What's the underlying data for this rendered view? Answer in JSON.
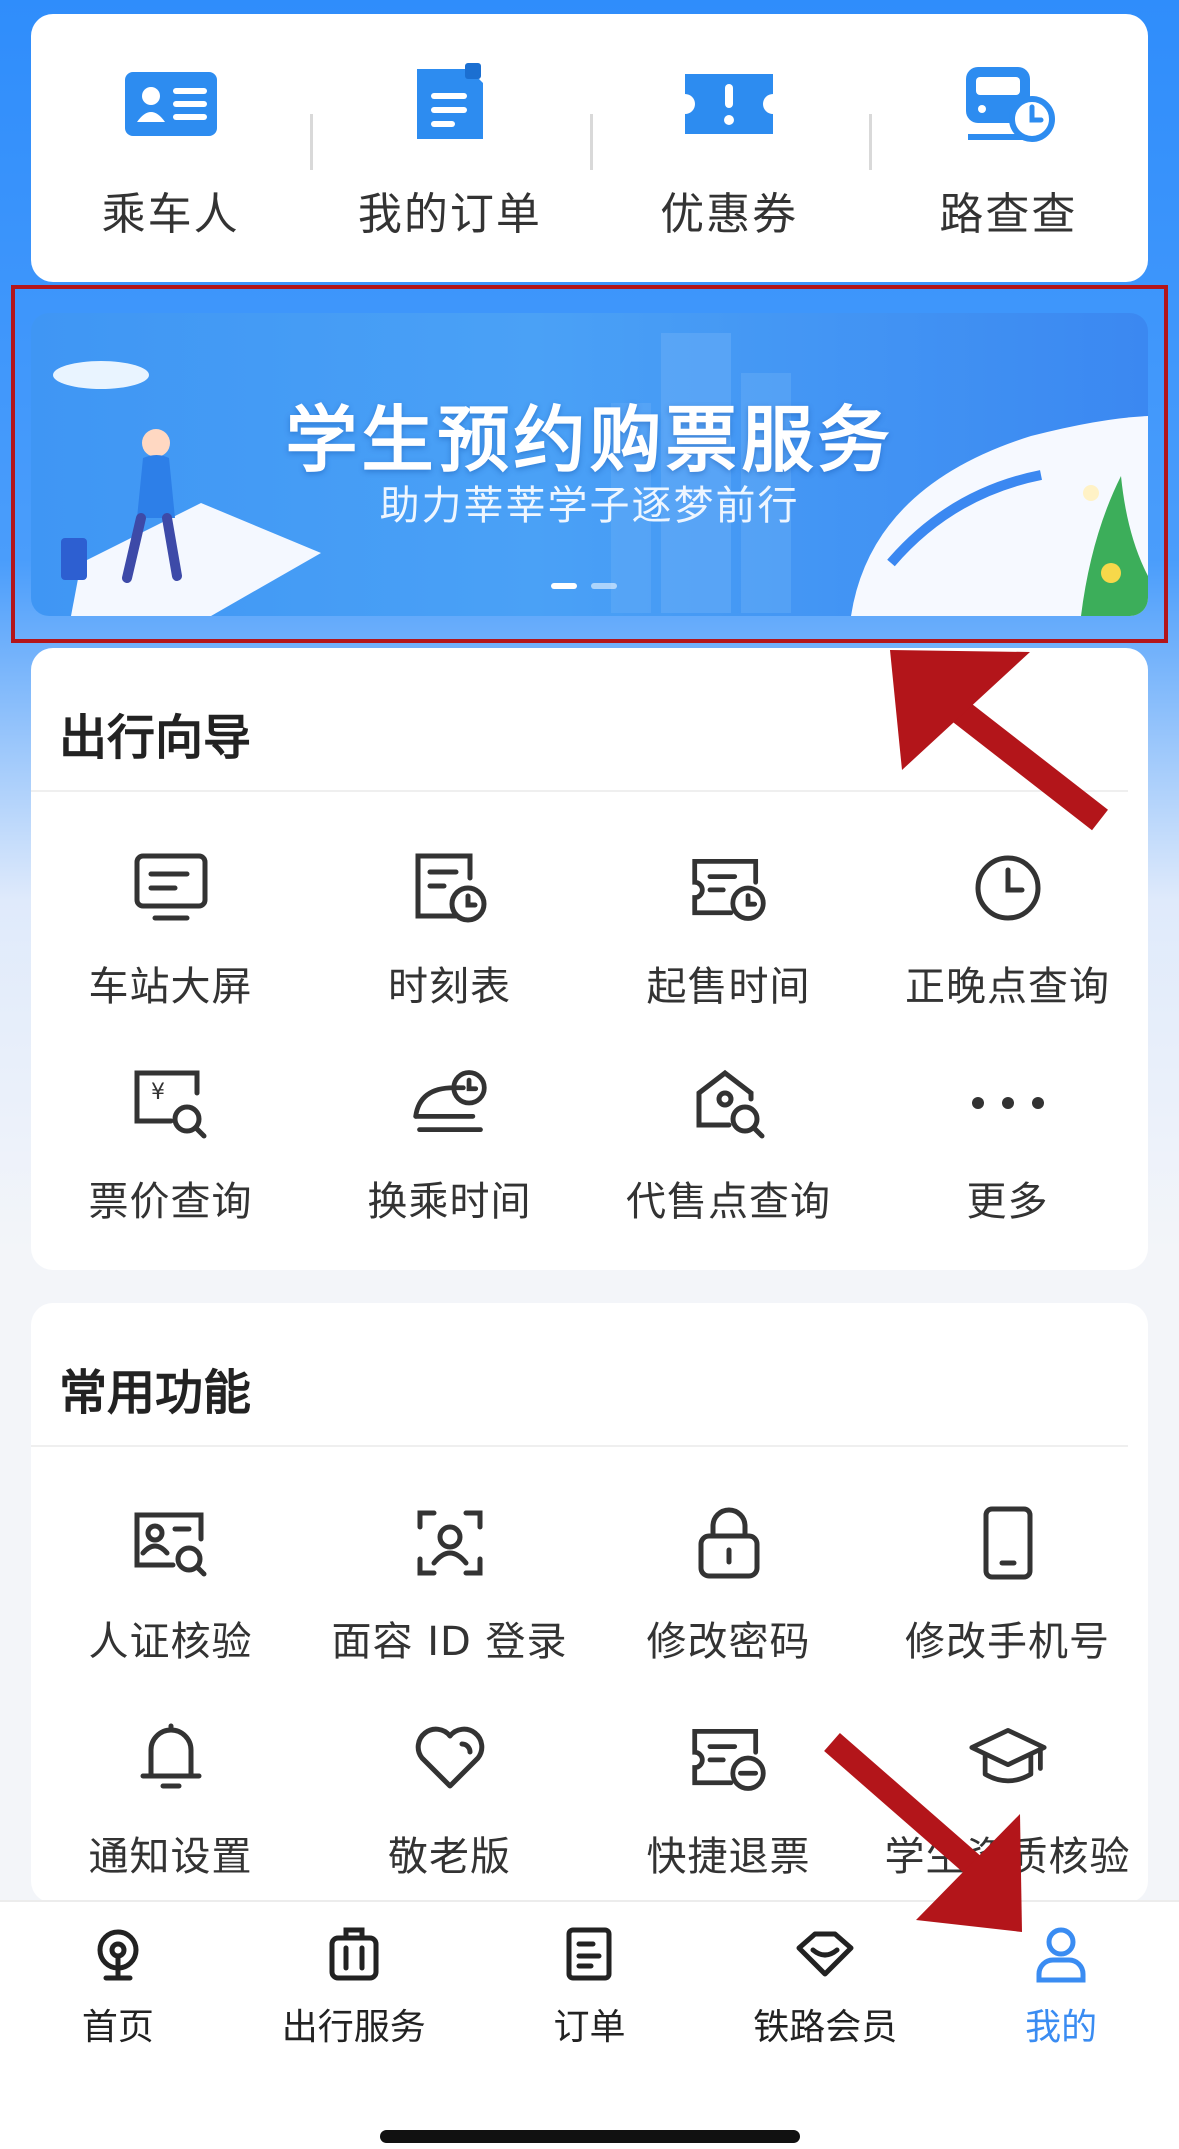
{
  "quick": [
    {
      "label": "乘车人",
      "icon": "passenger-card-icon"
    },
    {
      "label": "我的订单",
      "icon": "order-doc-icon"
    },
    {
      "label": "优惠券",
      "icon": "coupon-icon"
    },
    {
      "label": "路查查",
      "icon": "train-schedule-icon"
    }
  ],
  "banner": {
    "title": "学生预约购票服务",
    "subtitle": "助力莘莘学子逐梦前行"
  },
  "guide": {
    "title": "出行向导",
    "items": [
      {
        "label": "车站大屏",
        "icon": "station-screen-icon"
      },
      {
        "label": "时刻表",
        "icon": "timetable-icon"
      },
      {
        "label": "起售时间",
        "icon": "sale-time-icon"
      },
      {
        "label": "正晚点查询",
        "icon": "clock-icon"
      },
      {
        "label": "票价查询",
        "icon": "fare-search-icon"
      },
      {
        "label": "换乘时间",
        "icon": "transfer-time-icon"
      },
      {
        "label": "代售点查询",
        "icon": "agent-search-icon"
      },
      {
        "label": "更多",
        "icon": "more-dots-icon"
      }
    ]
  },
  "common": {
    "title": "常用功能",
    "items": [
      {
        "label": "人证核验",
        "icon": "id-verify-icon"
      },
      {
        "label": "面容 ID 登录",
        "icon": "face-id-icon"
      },
      {
        "label": "修改密码",
        "icon": "lock-icon"
      },
      {
        "label": "修改手机号",
        "icon": "phone-icon"
      },
      {
        "label": "通知设置",
        "icon": "bell-icon"
      },
      {
        "label": "敬老版",
        "icon": "heart-icon"
      },
      {
        "label": "快捷退票",
        "icon": "refund-ticket-icon"
      },
      {
        "label": "学生资质核验",
        "icon": "graduation-cap-icon"
      }
    ]
  },
  "tabs": [
    {
      "label": "首页",
      "icon": "home-train-icon"
    },
    {
      "label": "出行服务",
      "icon": "luggage-icon"
    },
    {
      "label": "订单",
      "icon": "order-icon"
    },
    {
      "label": "铁路会员",
      "icon": "diamond-icon"
    },
    {
      "label": "我的",
      "icon": "profile-icon",
      "active": true
    }
  ],
  "colors": {
    "accent": "#3a8cf2",
    "annotation": "#b3151a"
  }
}
